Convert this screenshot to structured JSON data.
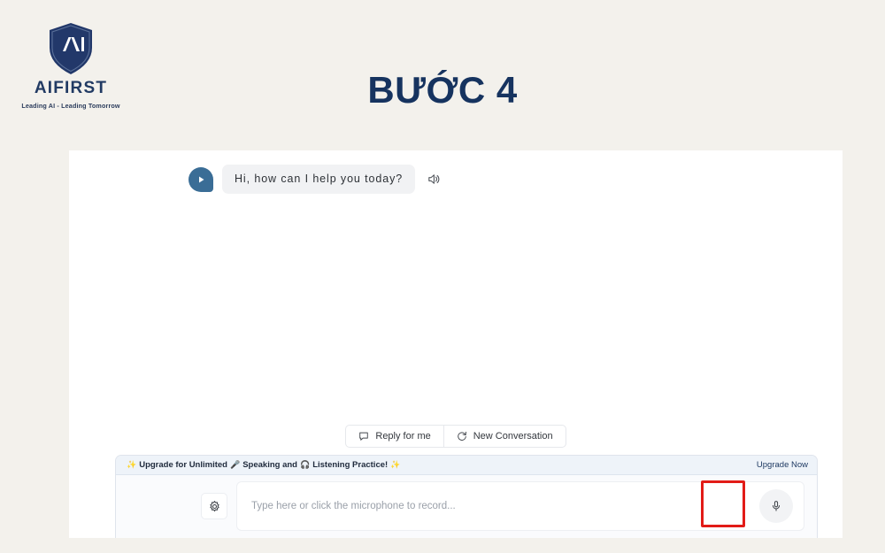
{
  "brand": {
    "shield_letters": "AI",
    "wordmark": "AIFIRST",
    "tagline": "Leading AI - Leading Tomorrow",
    "shield_color": "#22386a",
    "wordmark_color": "#213a63"
  },
  "page": {
    "title": "BƯỚC 4",
    "title_color": "#16335f",
    "background_color": "#f3f1ec",
    "panel_color": "#ffffff"
  },
  "chat": {
    "messages": [
      {
        "sender": "assistant",
        "text": "Hi, how can I help you today?",
        "avatar_icon": "play-icon",
        "speaker_icon": "speaker-icon"
      }
    ]
  },
  "actions": [
    {
      "label": "Reply for me",
      "icon": "chat-bubble-icon"
    },
    {
      "label": "New Conversation",
      "icon": "refresh-icon"
    }
  ],
  "composer": {
    "promo": {
      "sparkle_left": "✨",
      "text_1": "Upgrade for Unlimited",
      "mic_emoji": "🎤",
      "text_2": "Speaking and",
      "headphone_emoji": "🎧",
      "text_3": "Listening Practice!",
      "sparkle_right": "✨",
      "link_label": "Upgrade Now",
      "background_color": "#eef3f9",
      "text_color": "#1f2a3c",
      "link_color": "#1f3a63"
    },
    "settings_icon": "gear-icon",
    "input": {
      "value": "",
      "placeholder": "Type here or click the microphone to record..."
    },
    "mic_button": {
      "icon": "microphone-icon",
      "highlighted": true,
      "highlight_color": "#e21b17"
    }
  }
}
